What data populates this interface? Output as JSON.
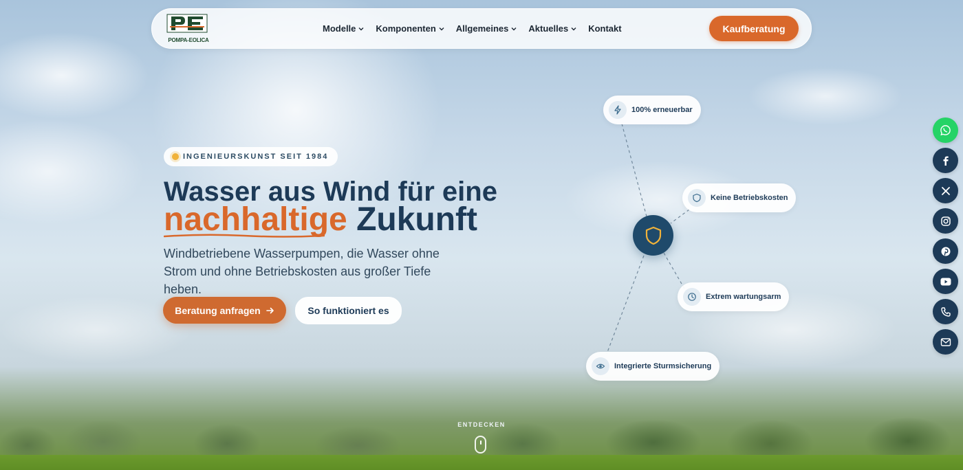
{
  "brand": {
    "logo_text": "POMPA-EOLICA",
    "accent": "#d9682b",
    "primary": "#1d3a57"
  },
  "nav": {
    "items": [
      {
        "label": "Modelle",
        "has_dropdown": true
      },
      {
        "label": "Komponenten",
        "has_dropdown": true
      },
      {
        "label": "Allgemeines",
        "has_dropdown": true
      },
      {
        "label": "Aktuelles",
        "has_dropdown": true
      },
      {
        "label": "Kontakt",
        "has_dropdown": false
      }
    ],
    "cta_label": "Kaufberatung"
  },
  "hero": {
    "badge": "INGENIEURSKUNST SEIT 1984",
    "title_line1": "Wasser aus Wind für eine",
    "title_accent": "nachhaltige",
    "title_rest": "Zukunft",
    "lead": "Windbetriebene Wasserpumpen, die Wasser ohne Strom und ohne Betriebskosten aus großer Tiefe heben.",
    "primary_button": "Beratung anfragen",
    "secondary_button": "So funktioniert es"
  },
  "features": [
    {
      "label": "100% erneuerbar",
      "icon": "bolt-icon"
    },
    {
      "label": "Keine Betriebskosten",
      "icon": "shield-icon"
    },
    {
      "label": "Extrem wartungsarm",
      "icon": "clock-icon"
    },
    {
      "label": "Integrierte Sturmsicherung",
      "icon": "eye-icon"
    }
  ],
  "hub_icon": "shield-icon",
  "social": [
    "whatsapp-icon",
    "facebook-icon",
    "x-icon",
    "instagram-icon",
    "pinterest-icon",
    "youtube-icon",
    "phone-icon",
    "mail-icon"
  ],
  "scroll_hint": "ENTDECKEN"
}
